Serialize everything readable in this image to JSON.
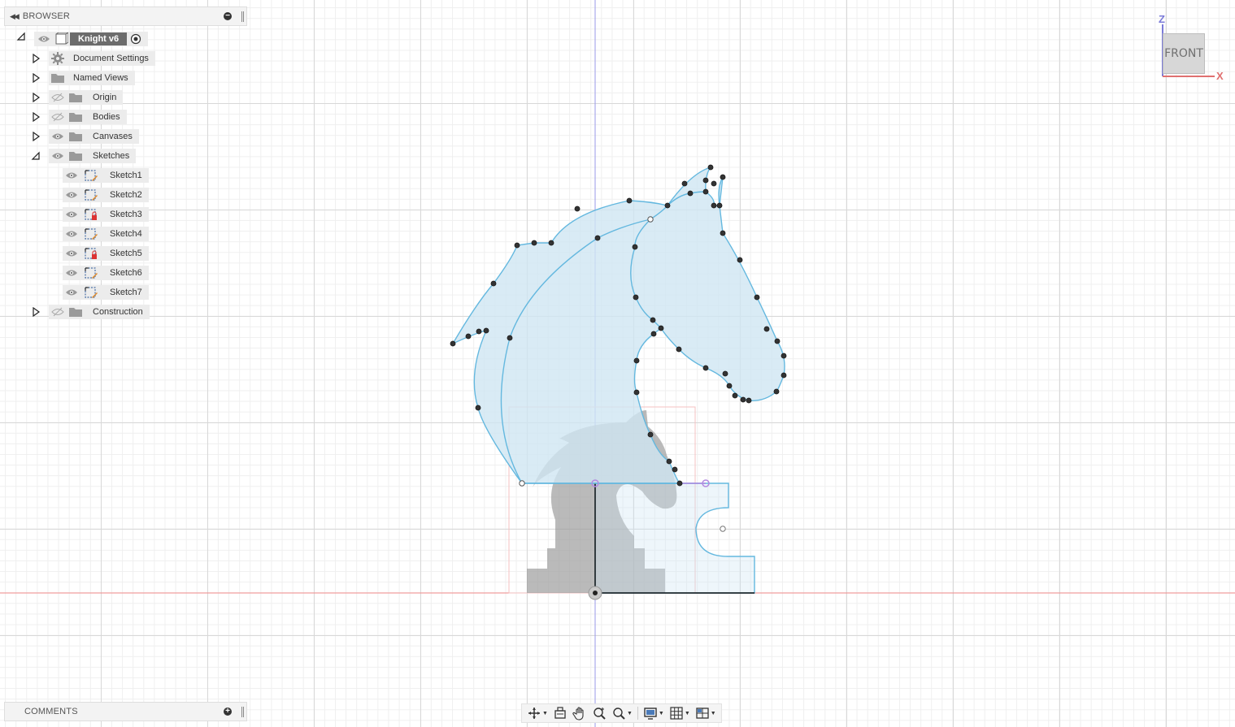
{
  "browser": {
    "title": "BROWSER",
    "root": {
      "name": "Knight v6"
    },
    "items": [
      {
        "label": "Document Settings",
        "icon": "gear-icon",
        "visibility": "none"
      },
      {
        "label": "Named Views",
        "icon": "folder-icon",
        "visibility": "none"
      },
      {
        "label": "Origin",
        "icon": "folder-icon",
        "visibility": "hidden"
      },
      {
        "label": "Bodies",
        "icon": "folder-icon",
        "visibility": "hidden"
      },
      {
        "label": "Canvases",
        "icon": "folder-icon",
        "visibility": "visible"
      },
      {
        "label": "Sketches",
        "icon": "folder-icon",
        "visibility": "visible",
        "expanded": true
      },
      {
        "label": "Construction",
        "icon": "folder-icon",
        "visibility": "hidden"
      }
    ],
    "sketches": [
      {
        "label": "Sketch1",
        "icon": "sketch-icon",
        "locked": false
      },
      {
        "label": "Sketch2",
        "icon": "sketch-icon",
        "locked": false
      },
      {
        "label": "Sketch3",
        "icon": "sketch-locked-icon",
        "locked": true
      },
      {
        "label": "Sketch4",
        "icon": "sketch-icon",
        "locked": false
      },
      {
        "label": "Sketch5",
        "icon": "sketch-locked-icon",
        "locked": true
      },
      {
        "label": "Sketch6",
        "icon": "sketch-icon",
        "locked": false
      },
      {
        "label": "Sketch7",
        "icon": "sketch-icon",
        "locked": false
      }
    ]
  },
  "comments": {
    "title": "COMMENTS"
  },
  "viewcube": {
    "face": "FRONT",
    "axis_z": "Z",
    "axis_x": "X"
  },
  "toolbar": [
    {
      "name": "orbit-tool",
      "icon": "orbit-icon",
      "has_dropdown": true
    },
    {
      "name": "look-at-tool",
      "icon": "look-at-icon",
      "has_dropdown": false
    },
    {
      "name": "pan-tool",
      "icon": "hand-icon",
      "has_dropdown": false
    },
    {
      "name": "zoom-tool",
      "icon": "zoom-icon",
      "has_dropdown": false
    },
    {
      "name": "fit-tool",
      "icon": "zoom-window-icon",
      "has_dropdown": true
    },
    {
      "name": "display-settings",
      "icon": "display-icon",
      "has_dropdown": true
    },
    {
      "name": "grid-settings",
      "icon": "grid-icon",
      "has_dropdown": true
    },
    {
      "name": "viewports",
      "icon": "viewports-icon",
      "has_dropdown": true
    }
  ],
  "colors": {
    "sketch_fill": "#cfe6f3",
    "sketch_stroke": "#64b8df",
    "x_axis": "#f08a8a",
    "z_axis": "#9a9ae8",
    "canvas_image": "#9c9c9c",
    "accent_root": "#6c6c6c"
  }
}
